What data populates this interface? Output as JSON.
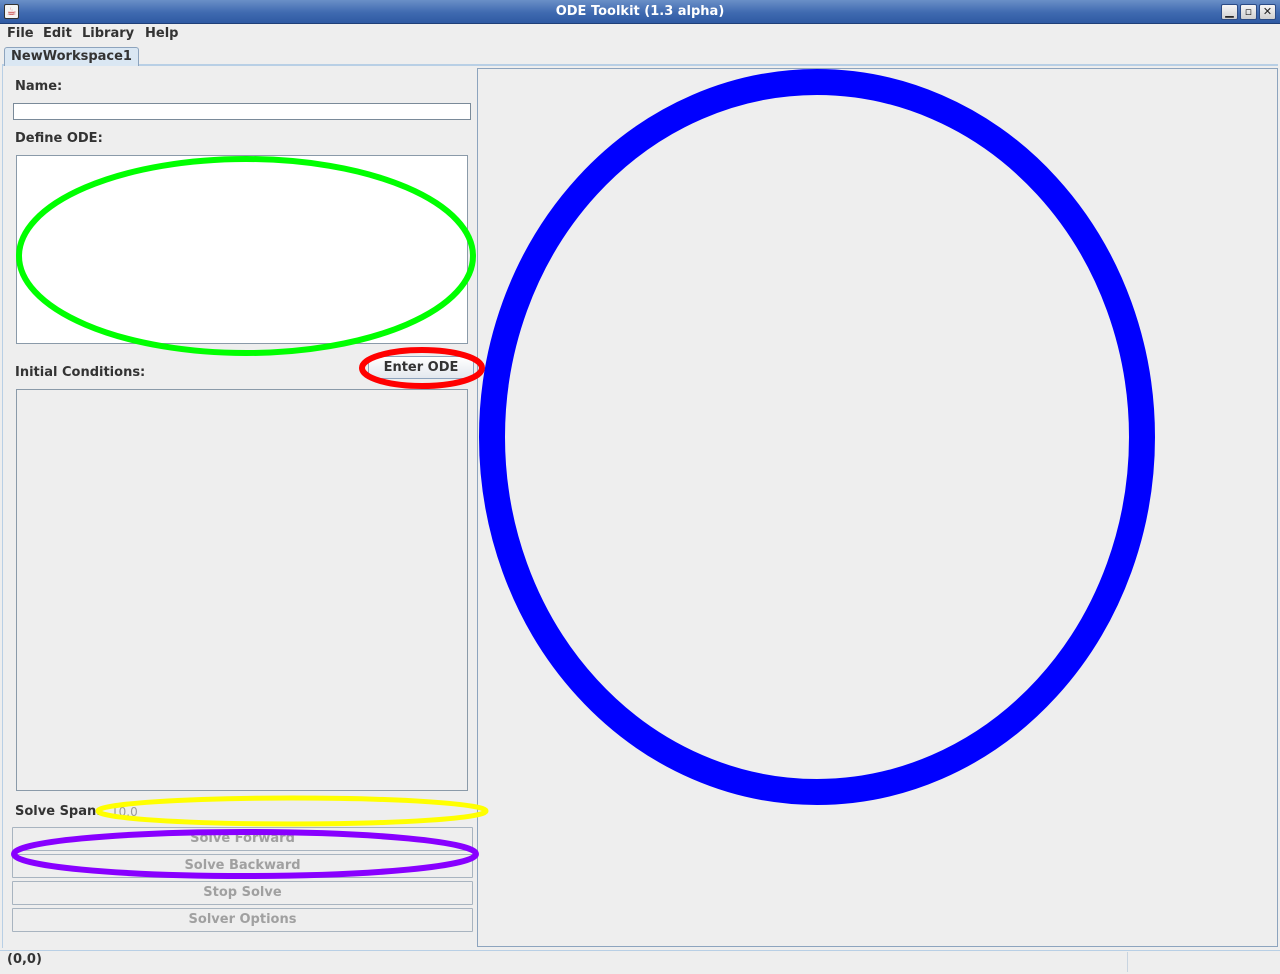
{
  "window": {
    "title": "ODE Toolkit (1.3 alpha)",
    "minimize_glyph": "▁",
    "maximize_glyph": "▫",
    "close_glyph": "✕"
  },
  "menu": {
    "file": "File",
    "edit": "Edit",
    "library": "Library",
    "help": "Help"
  },
  "tabs": [
    {
      "label": "NewWorkspace1"
    }
  ],
  "form": {
    "name_label": "Name:",
    "name_value": "",
    "define_label": "Define ODE:",
    "ode_value": "",
    "enter_button": "Enter ODE",
    "initial_label": "Initial Conditions:",
    "span_label": "Solve Span:",
    "span_value": "10.0"
  },
  "actions": {
    "solve_forward": "Solve Forward",
    "solve_backward": "Solve Backward",
    "stop_solve": "Stop Solve",
    "solver_options": "Solver Options"
  },
  "status": {
    "coords": "(0,0)"
  },
  "annotations": {
    "colors": {
      "green": "#00ff00",
      "red": "#ff0000",
      "blue": "#0000ff",
      "yellow": "#ffff00",
      "purple": "#8800ff"
    }
  }
}
